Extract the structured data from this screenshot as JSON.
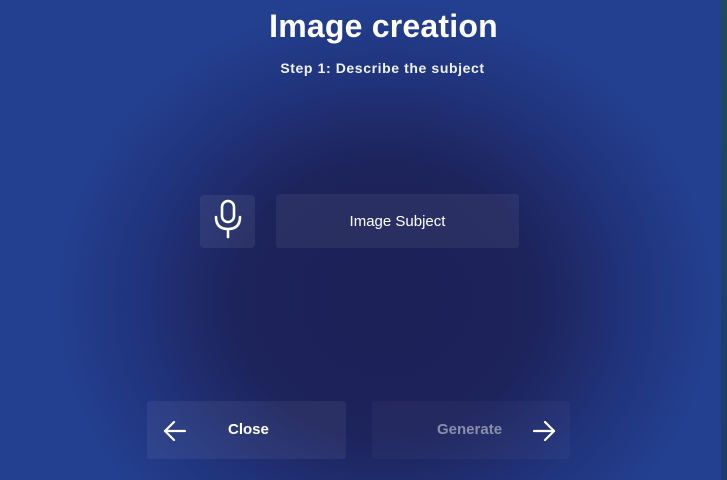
{
  "header": {
    "title": "Image creation",
    "subtitle": "Step 1: Describe the subject"
  },
  "input": {
    "mic_icon": "microphone-icon",
    "subject_label": "Image Subject"
  },
  "footer": {
    "close_label": "Close",
    "close_icon": "arrow-left-icon",
    "generate_label": "Generate",
    "generate_icon": "arrow-right-icon",
    "generate_enabled": false
  },
  "colors": {
    "background": "#1d235b",
    "background_edge": "#22408f",
    "text": "#ffffff",
    "disabled_text": "#8b8fa8"
  }
}
